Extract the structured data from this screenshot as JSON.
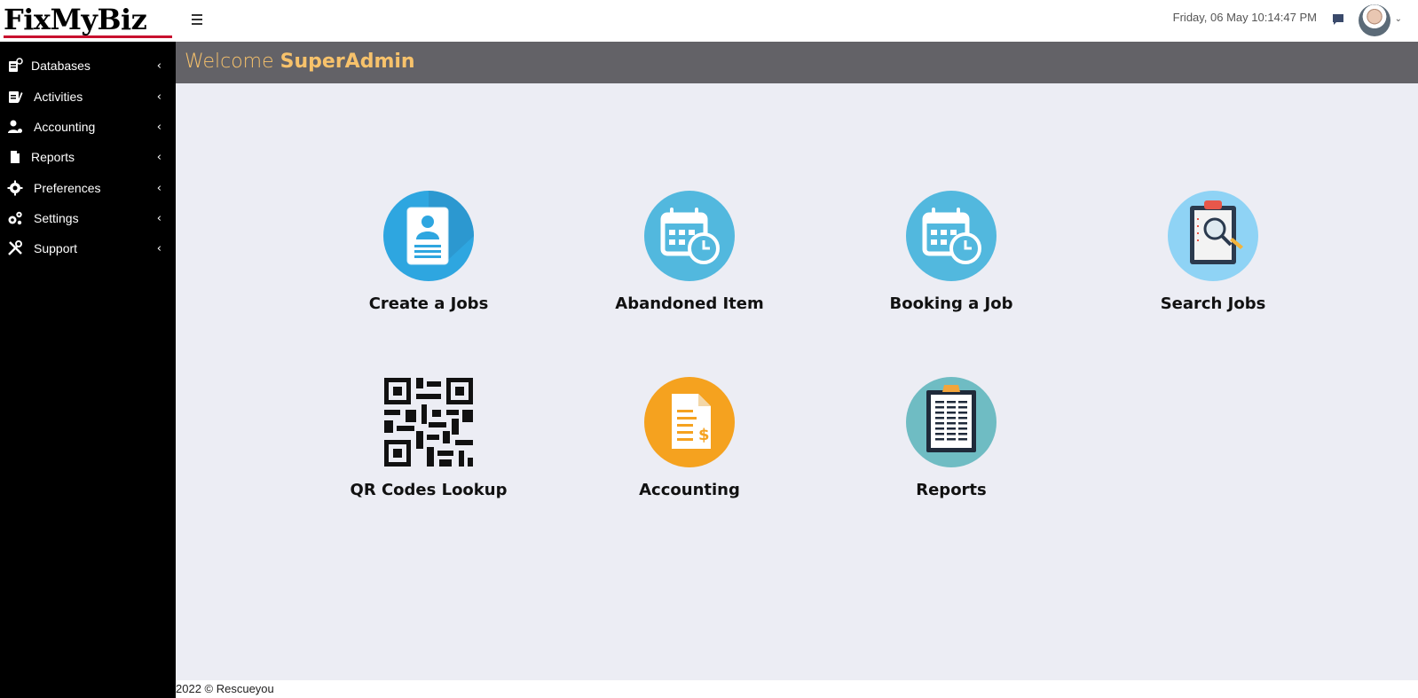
{
  "brand": {
    "name": "FixMyBiz"
  },
  "topbar": {
    "datetime": "Friday, 06 May 10:14:47 PM"
  },
  "sidebar": {
    "items": [
      {
        "label": "Databases",
        "icon": "database-icon"
      },
      {
        "label": "Activities",
        "icon": "clipboard-pen-icon"
      },
      {
        "label": "Accounting",
        "icon": "user-gear-icon"
      },
      {
        "label": "Reports",
        "icon": "file-icon"
      },
      {
        "label": "Preferences",
        "icon": "gear-icon"
      },
      {
        "label": "Settings",
        "icon": "gears-icon"
      },
      {
        "label": "Support",
        "icon": "tools-icon"
      }
    ]
  },
  "welcome": {
    "prefix": "Welcome",
    "user": "SuperAdmin"
  },
  "tiles": [
    {
      "label": "Create a Jobs",
      "icon": "contact-card-icon"
    },
    {
      "label": "Abandoned Item",
      "icon": "calendar-clock-icon"
    },
    {
      "label": "Booking a Job",
      "icon": "calendar-clock-icon"
    },
    {
      "label": "Search Jobs",
      "icon": "clipboard-search-icon"
    },
    {
      "label": "QR Codes Lookup",
      "icon": "qr-code-icon"
    },
    {
      "label": "Accounting",
      "icon": "invoice-dollar-icon"
    },
    {
      "label": "Reports",
      "icon": "report-clipboard-icon"
    }
  ],
  "footer": {
    "text": "2022 © Rescueyou"
  },
  "colors": {
    "sidebar_bg": "#000000",
    "header_bg": "#636267",
    "welcome_text": "#f7c26b",
    "main_bg": "#ecedf4",
    "brand_underline": "#c8102e",
    "tile_blue": "#52b8de",
    "tile_orange": "#f5a21f",
    "tile_teal": "#6fbcc3"
  }
}
